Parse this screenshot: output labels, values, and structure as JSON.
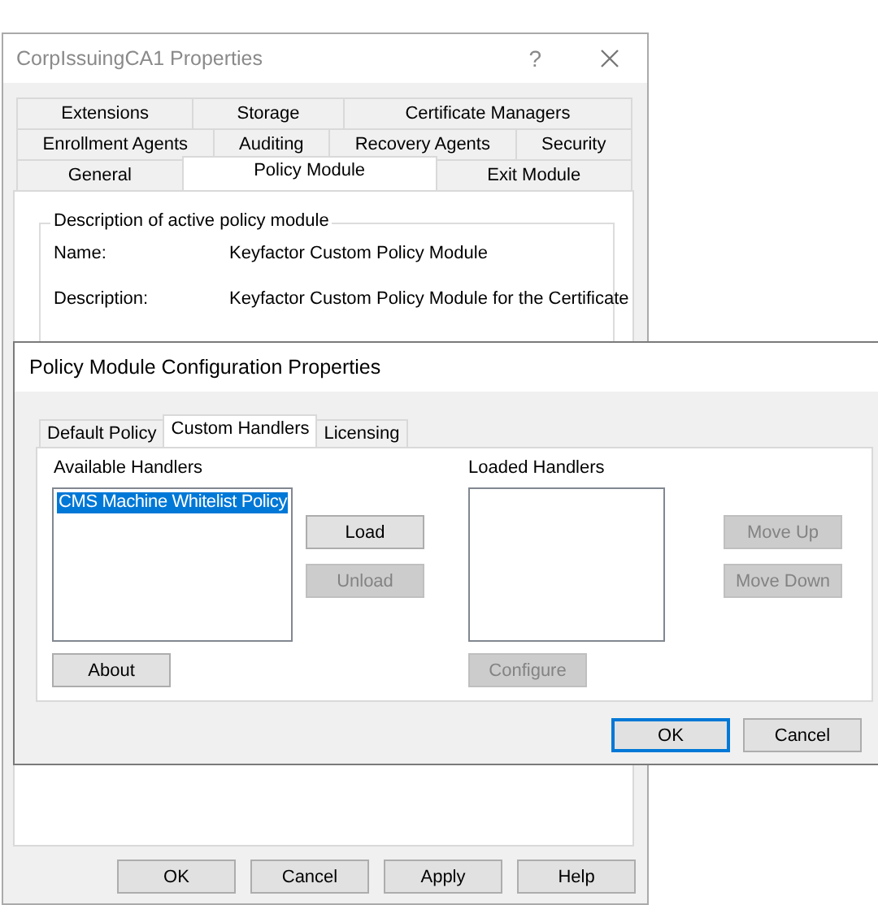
{
  "properties_window": {
    "title": "CorpIssuingCA1 Properties",
    "help_glyph": "?",
    "tab_rows": [
      [
        {
          "label": "Extensions",
          "selected": false
        },
        {
          "label": "Storage",
          "selected": false
        },
        {
          "label": "Certificate Managers",
          "selected": false
        }
      ],
      [
        {
          "label": "Enrollment Agents",
          "selected": false
        },
        {
          "label": "Auditing",
          "selected": false
        },
        {
          "label": "Recovery Agents",
          "selected": false
        },
        {
          "label": "Security",
          "selected": false
        }
      ],
      [
        {
          "label": "General",
          "selected": false
        },
        {
          "label": "Policy Module",
          "selected": true
        },
        {
          "label": "Exit Module",
          "selected": false
        }
      ]
    ],
    "group_title": "Description of active policy module",
    "fields": [
      {
        "label": "Name:",
        "value": "Keyfactor Custom Policy Module"
      },
      {
        "label": "Description:",
        "value": "Keyfactor Custom Policy Module for the Certificate"
      }
    ],
    "buttons": [
      "OK",
      "Cancel",
      "Apply",
      "Help"
    ]
  },
  "config_dialog": {
    "title": "Policy Module Configuration Properties",
    "tabs": [
      {
        "label": "Default Policy",
        "selected": false
      },
      {
        "label": "Custom Handlers",
        "selected": true
      },
      {
        "label": "Licensing",
        "selected": false
      }
    ],
    "available_handlers": {
      "label": "Available Handlers",
      "items": [
        {
          "text": "CMS Machine Whitelist Policy",
          "selected": true
        }
      ]
    },
    "load_buttons": [
      {
        "label": "Load",
        "disabled": false
      },
      {
        "label": "Unload",
        "disabled": true
      }
    ],
    "about_button": {
      "label": "About",
      "disabled": false
    },
    "loaded_handlers": {
      "label": "Loaded Handlers"
    },
    "order_buttons": [
      {
        "label": "Move Up",
        "disabled": true
      },
      {
        "label": "Move Down",
        "disabled": true
      }
    ],
    "configure_button": {
      "label": "Configure",
      "disabled": true
    },
    "buttons": [
      {
        "label": "OK",
        "default": true
      },
      {
        "label": "Cancel",
        "default": false
      }
    ]
  }
}
